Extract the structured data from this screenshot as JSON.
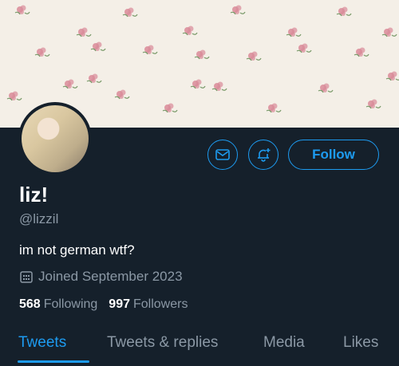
{
  "profile": {
    "display_name": "liz!",
    "handle": "@lizzil",
    "bio": "im not german wtf?",
    "joined": "Joined September 2023"
  },
  "actions": {
    "follow_label": "Follow",
    "message_icon": "envelope-icon",
    "notify_icon": "bell-plus-icon"
  },
  "stats": {
    "following_count": "568",
    "following_label": "Following",
    "followers_count": "997",
    "followers_label": "Followers"
  },
  "tabs": [
    {
      "label": "Tweets",
      "active": true
    },
    {
      "label": "Tweets & replies",
      "active": false
    },
    {
      "label": "Media",
      "active": false
    },
    {
      "label": "Likes",
      "active": false
    }
  ],
  "colors": {
    "background": "#15202b",
    "accent": "#1d9bf0",
    "secondary_text": "#8b98a5",
    "banner": "#f4efe7",
    "flower": "#d98a98"
  }
}
